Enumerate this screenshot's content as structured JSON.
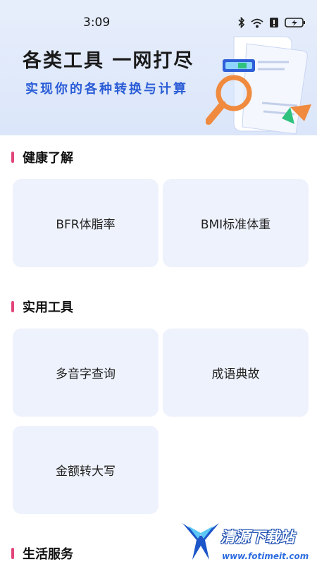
{
  "status_bar": {
    "time": "3:09",
    "icons": [
      "bluetooth-icon",
      "wifi-icon",
      "alert-icon",
      "battery-charging-icon"
    ]
  },
  "banner": {
    "title": "各类工具 一网打尽",
    "subtitle": "实现你的各种转换与计算"
  },
  "sections": [
    {
      "title": "健康了解",
      "items": [
        {
          "label": "BFR体脂率"
        },
        {
          "label": "BMI标准体重"
        }
      ]
    },
    {
      "title": "实用工具",
      "items": [
        {
          "label": "多音字查询"
        },
        {
          "label": "成语典故"
        },
        {
          "label": "金额转大写"
        }
      ]
    },
    {
      "title": "生活服务",
      "items": []
    }
  ],
  "watermark": {
    "title": "清源下载站",
    "url": "www.fotimeit.com"
  },
  "colors": {
    "accent_bar": "#e2457b",
    "card_background": "#eef2fc",
    "subtitle_blue": "#2a5cd6"
  }
}
